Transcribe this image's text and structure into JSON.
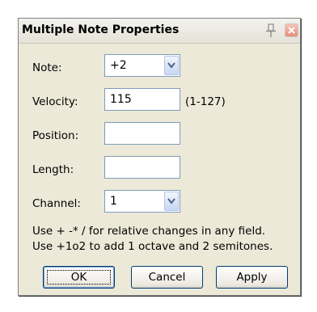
{
  "window": {
    "title": "Multiple Note Properties",
    "pin_icon": "pin-icon",
    "close_icon": "close-icon"
  },
  "fields": {
    "note": {
      "label": "Note:",
      "value": "+2"
    },
    "velocity": {
      "label": "Velocity:",
      "value": "115",
      "range": "(1-127)"
    },
    "position": {
      "label": "Position:",
      "value": ""
    },
    "length": {
      "label": "Length:",
      "value": ""
    },
    "channel": {
      "label": "Channel:",
      "value": "1"
    }
  },
  "help": {
    "line1": "Use + -* / for relative changes in any field.",
    "line2": "Use +1o2  to add 1 octave and 2 semitones."
  },
  "buttons": {
    "ok": "OK",
    "cancel": "Cancel",
    "apply": "Apply"
  },
  "colors": {
    "dialog_bg": "#ece9d8",
    "field_border": "#7f9db9",
    "close_button": "#e59076",
    "combo_button": "#c7d6f3"
  }
}
